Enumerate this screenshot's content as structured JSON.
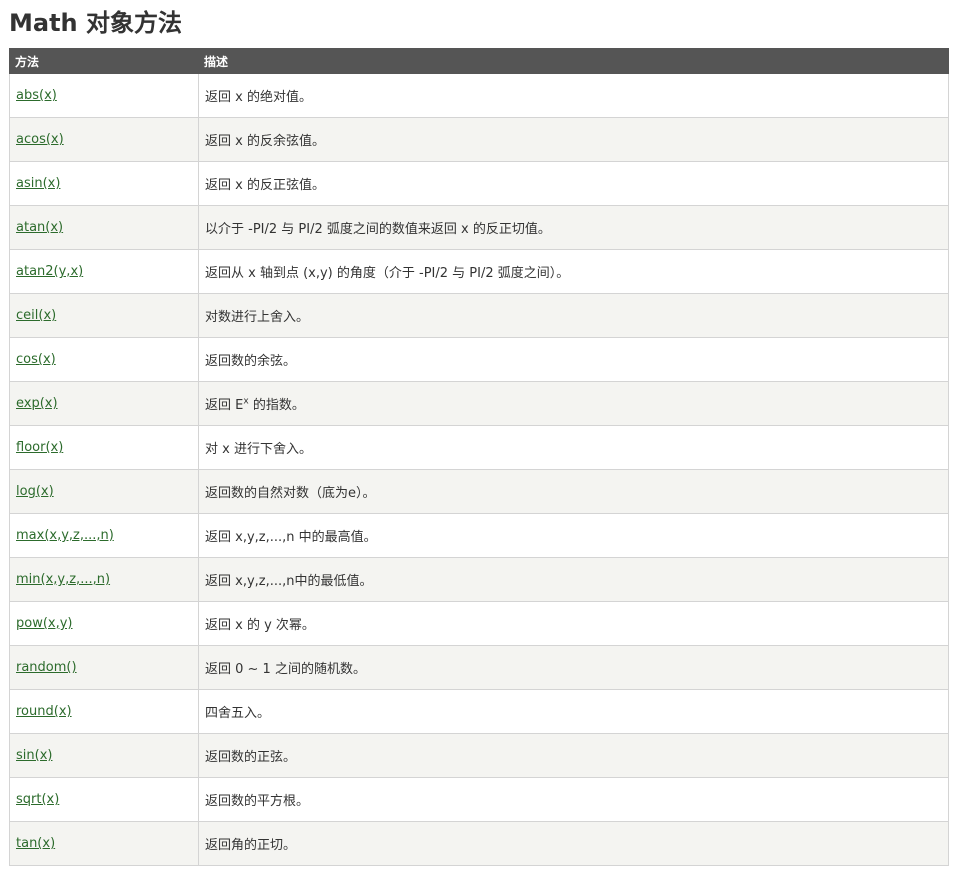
{
  "page": {
    "title": "Math 对象方法"
  },
  "table": {
    "headers": {
      "method": "方法",
      "description": "描述"
    },
    "rows": [
      {
        "method": "abs(x)",
        "description": "返回 x 的绝对值。"
      },
      {
        "method": "acos(x)",
        "description": "返回 x 的反余弦值。"
      },
      {
        "method": "asin(x)",
        "description": "返回 x 的反正弦值。"
      },
      {
        "method": "atan(x)",
        "description": "以介于 -PI/2 与 PI/2 弧度之间的数值来返回 x 的反正切值。"
      },
      {
        "method": "atan2(y,x)",
        "description": "返回从 x 轴到点 (x,y) 的角度（介于 -PI/2 与 PI/2 弧度之间）。"
      },
      {
        "method": "ceil(x)",
        "description": "对数进行上舍入。"
      },
      {
        "method": "cos(x)",
        "description": "返回数的余弦。"
      },
      {
        "method": "exp(x)",
        "description_before": "返回 E",
        "description_sup": "x",
        "description_after": " 的指数。"
      },
      {
        "method": "floor(x)",
        "description": "对 x 进行下舍入。"
      },
      {
        "method": "log(x)",
        "description": "返回数的自然对数（底为e）。"
      },
      {
        "method": "max(x,y,z,...,n)",
        "description": "返回 x,y,z,...,n 中的最高值。"
      },
      {
        "method": "min(x,y,z,...,n)",
        "description": "返回 x,y,z,...,n中的最低值。"
      },
      {
        "method": "pow(x,y)",
        "description": "返回 x 的 y 次幂。"
      },
      {
        "method": "random()",
        "description": "返回 0 ~ 1 之间的随机数。"
      },
      {
        "method": "round(x)",
        "description": "四舍五入。"
      },
      {
        "method": "sin(x)",
        "description": "返回数的正弦。"
      },
      {
        "method": "sqrt(x)",
        "description": "返回数的平方根。"
      },
      {
        "method": "tan(x)",
        "description": "返回角的正切。"
      }
    ]
  },
  "colors": {
    "header_bg": "#555555",
    "row_alt_bg": "#f4f4f1",
    "link": "#2c6b2c",
    "text": "#333333",
    "border": "#d4d4d4"
  }
}
